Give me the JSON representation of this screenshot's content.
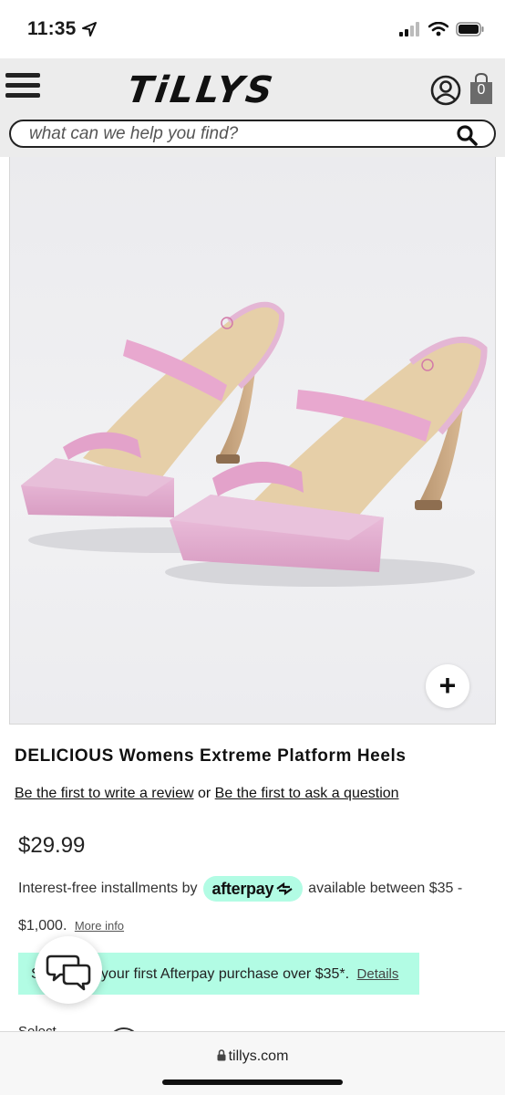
{
  "status_bar": {
    "time": "11:35"
  },
  "header": {
    "logo_text": "TiLLYS",
    "bag_count": "0",
    "search": {
      "placeholder": "what can we help you find?"
    }
  },
  "product": {
    "title": "DELICIOUS Womens Extreme Platform Heels",
    "review_link": "Be the first to write a review",
    "review_or": "or",
    "question_link": "Be the first to ask a question",
    "price": "$29.99",
    "zoom_label": "+"
  },
  "afterpay": {
    "prefix": "Interest-free installments by",
    "badge_text": "afterpay",
    "range_part1": "available between $35 -",
    "range_part2": "$1,000.",
    "more_info": "More info",
    "promo_text": "h your first Afterpay purchase over $35*.",
    "promo_prefix": "S",
    "details_link": "Details",
    "brand_color": "#b2fce4"
  },
  "options": {
    "select_label": "Select"
  },
  "browser": {
    "url": "tillys.com"
  },
  "icons": [
    "location-arrow-icon",
    "cellular-signal-icon",
    "wifi-icon",
    "battery-icon",
    "hamburger-menu-icon",
    "account-icon",
    "shopping-bag-icon",
    "search-icon",
    "plus-icon",
    "chat-bubbles-icon",
    "lock-icon"
  ]
}
